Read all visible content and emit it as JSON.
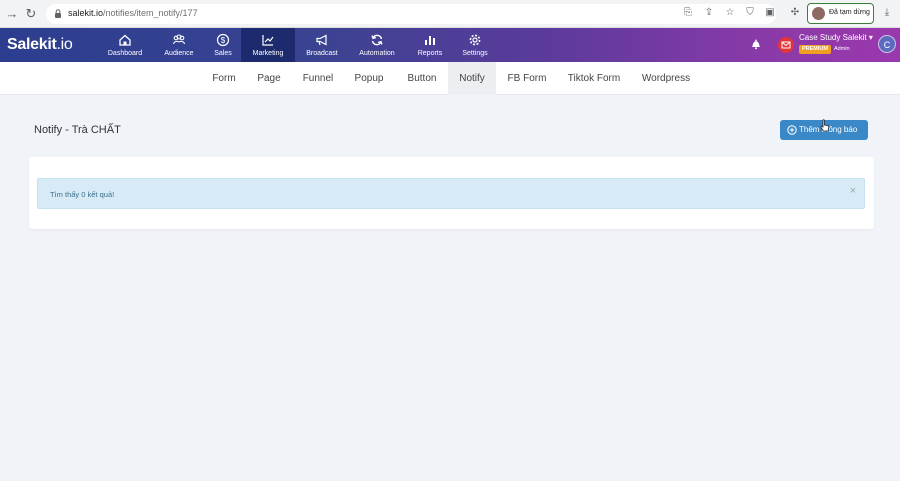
{
  "browser": {
    "url_host": "salekit.io",
    "url_path": "/notifies/item_notify/177",
    "paused_label": "Đã tạm dừng"
  },
  "app": {
    "logo": "Salekit",
    "logo_suffix": ".io",
    "menu": [
      {
        "label": "Dashboard",
        "icon": "home-icon"
      },
      {
        "label": "Audience",
        "icon": "users-icon"
      },
      {
        "label": "Sales",
        "icon": "dollar-icon"
      },
      {
        "label": "Marketing",
        "icon": "chart-icon",
        "active": true
      },
      {
        "label": "Broadcast",
        "icon": "megaphone-icon"
      },
      {
        "label": "Automation",
        "icon": "refresh-icon"
      },
      {
        "label": "Reports",
        "icon": "bar-chart-icon"
      },
      {
        "label": "Settings",
        "icon": "gear-icon"
      }
    ],
    "user": {
      "name": "Case Study Salekit",
      "badge": "PREMIUM",
      "role": "Admin",
      "avatar_letter": "C"
    }
  },
  "subnav": {
    "tabs": [
      "Form",
      "Page",
      "Funnel",
      "Popup",
      "Button",
      "Notify",
      "FB Form",
      "Tiktok Form",
      "Wordpress"
    ],
    "active": "Notify"
  },
  "main": {
    "title": "Notify - Trà CHẤT",
    "add_button": "Thêm thông báo",
    "alert_message": "Tìm thấy 0 kết quả!",
    "alert_close": "×"
  },
  "colors": {
    "accent": "#3a88c8",
    "header_start": "#2c3d8f",
    "header_end": "#9b38ad",
    "alert_bg": "#d7ebf6"
  }
}
